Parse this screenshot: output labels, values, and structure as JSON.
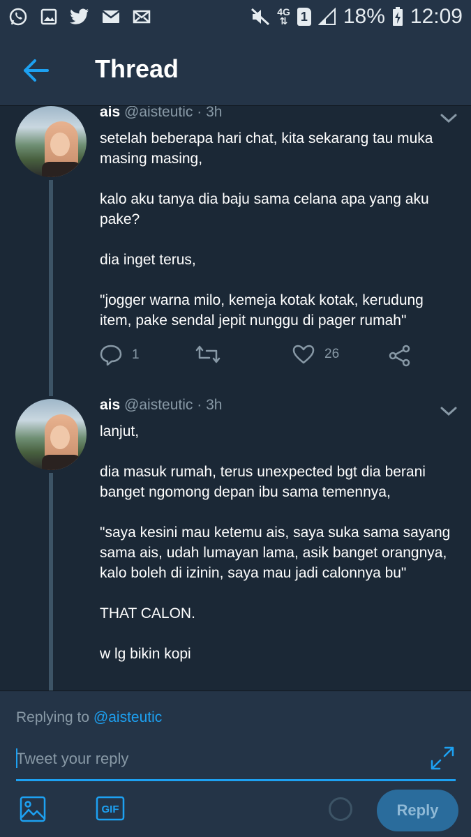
{
  "status_bar": {
    "network": "4G",
    "sim": "1",
    "battery": "18%",
    "time": "12:09"
  },
  "header": {
    "title": "Thread"
  },
  "tweets": [
    {
      "name": "ais",
      "handle": "@aisteutic",
      "dot": "·",
      "time": "3h",
      "paragraphs": [
        "setelah beberapa hari chat, kita sekarang tau muka masing masing,",
        "kalo aku tanya dia baju sama celana apa yang aku pake?",
        "dia inget terus,",
        "\"jogger warna milo, kemeja kotak kotak, kerudung item, pake sendal jepit nunggu di pager rumah\""
      ],
      "reply_count": "1",
      "like_count": "26"
    },
    {
      "name": "ais",
      "handle": "@aisteutic",
      "dot": "·",
      "time": "3h",
      "paragraphs": [
        "lanjut,",
        "dia masuk rumah, terus unexpected bgt  dia berani banget ngomong depan ibu sama temennya,",
        "\"saya kesini mau ketemu ais, saya suka sama sayang sama ais, udah lumayan lama, asik banget orangnya, kalo boleh di izinin, saya mau jadi calonnya bu\"",
        "THAT CALON.",
        "w lg bikin kopi"
      ]
    }
  ],
  "composer": {
    "replying_prefix": "Replying to",
    "replying_handle": "@aisteutic",
    "placeholder": "Tweet your reply",
    "gif_label": "GIF",
    "reply_label": "Reply"
  },
  "colors": {
    "accent": "#1da1f2",
    "header_bg": "#243447",
    "feed_bg": "#1b2836",
    "muted": "#8899a6"
  }
}
